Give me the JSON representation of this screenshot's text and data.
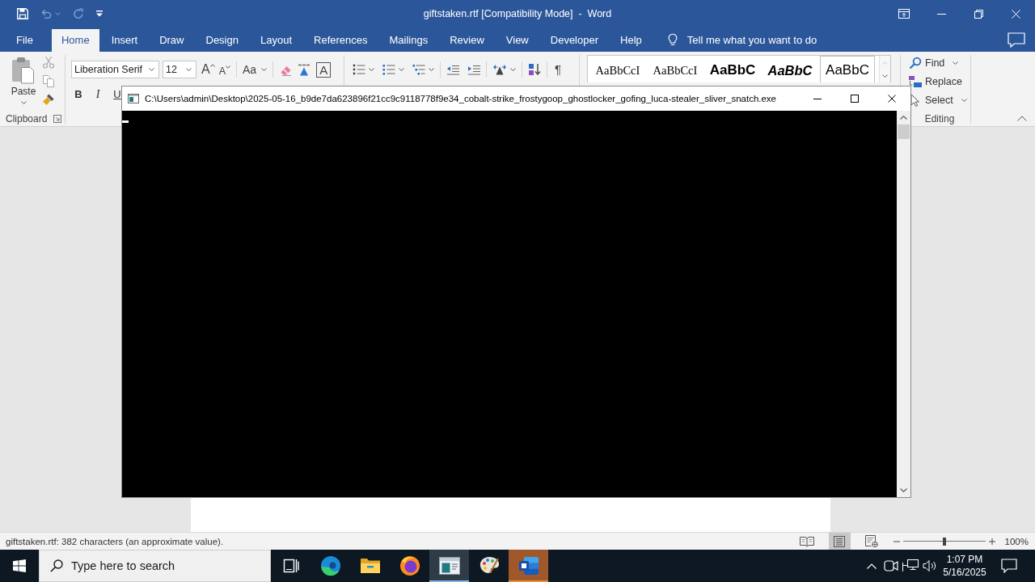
{
  "word_window": {
    "quick_access": [
      {
        "kind": "save",
        "disabled": false
      },
      {
        "kind": "undo",
        "disabled": true
      },
      {
        "kind": "repeat",
        "disabled": true
      },
      {
        "kind": "customize",
        "disabled": false
      }
    ],
    "title": "giftstaken.rtf [Compatibility Mode]  -  Word",
    "window_controls": [
      {
        "kind": "ribbon-options"
      },
      {
        "kind": "minimize"
      },
      {
        "kind": "restore"
      },
      {
        "kind": "close"
      }
    ],
    "tabs": [
      {
        "label": "File",
        "selected": false
      },
      {
        "label": "Home",
        "selected": true
      },
      {
        "label": "Insert",
        "selected": false
      },
      {
        "label": "Draw",
        "selected": false
      },
      {
        "label": "Design",
        "selected": false
      },
      {
        "label": "Layout",
        "selected": false
      },
      {
        "label": "References",
        "selected": false
      },
      {
        "label": "Mailings",
        "selected": false
      },
      {
        "label": "Review",
        "selected": false
      },
      {
        "label": "View",
        "selected": false
      },
      {
        "label": "Developer",
        "selected": false
      },
      {
        "label": "Help",
        "selected": false
      }
    ],
    "tell_me": {
      "placeholder": "Tell me what you want to do"
    },
    "ribbon": {
      "clipboard": {
        "paste": {
          "label": "Paste",
          "disabled": true
        },
        "tools": [
          {
            "kind": "cut",
            "disabled": true
          },
          {
            "kind": "copy",
            "disabled": true
          },
          {
            "kind": "format-painter",
            "disabled": false
          }
        ],
        "group_label": "Clipboard"
      },
      "font": {
        "font_name": "Liberation Serif",
        "font_size": "12",
        "tools": [
          [
            {
              "kind": "grow",
              "label": "A"
            },
            {
              "kind": "shrink",
              "label": "A"
            }
          ],
          [
            {
              "kind": "change-case",
              "label": "Aa"
            }
          ],
          [
            {
              "kind": "clear-formatting"
            },
            {
              "kind": "phonetic-guide"
            },
            {
              "kind": "character-border",
              "label": "A"
            }
          ]
        ],
        "format": [
          {
            "kind": "bold",
            "label": "B"
          },
          {
            "kind": "italic",
            "label": "I"
          },
          {
            "kind": "underline",
            "label": "U"
          }
        ]
      },
      "paragraph": {
        "tools": [
          [
            {
              "kind": "bullets"
            },
            {
              "kind": "numbering"
            },
            {
              "kind": "multilevel"
            }
          ],
          [
            {
              "kind": "decrease-indent"
            },
            {
              "kind": "increase-indent"
            }
          ],
          [
            {
              "kind": "character-scaling"
            }
          ],
          [
            {
              "kind": "sort"
            }
          ],
          [
            {
              "kind": "show-marks",
              "label": "¶"
            }
          ]
        ]
      },
      "styles": [
        {
          "kind": "serif",
          "sample": "AaBbCcI",
          "selected": false
        },
        {
          "kind": "serif",
          "sample": "AaBbCcI",
          "selected": false
        },
        {
          "kind": "sans-large",
          "sample": "AaBbC",
          "selected": false
        },
        {
          "kind": "sans-italic",
          "sample": "AaBbC",
          "selected": false
        },
        {
          "kind": "sans",
          "sample": "AaBbC",
          "selected": true
        }
      ],
      "gallery_scroll": [
        {
          "kind": "up",
          "disabled": true
        },
        {
          "kind": "down",
          "disabled": false
        }
      ],
      "editing": {
        "tools": [
          {
            "kind": "find",
            "label": "Find"
          },
          {
            "kind": "replace",
            "label": "Replace"
          },
          {
            "kind": "select",
            "label": "Select"
          }
        ],
        "group_label": "Editing"
      }
    },
    "status_bar": {
      "text": "giftstaken.rtf: 382 characters (an approximate value).",
      "views": [
        {
          "kind": "read",
          "selected": false
        },
        {
          "kind": "print",
          "selected": true
        },
        {
          "kind": "web",
          "selected": false
        }
      ],
      "zoom": {
        "level": 0.5,
        "reading": "100%"
      }
    }
  },
  "console_window": {
    "title": "C:\\Users\\admin\\Desktop\\2025-05-16_b9de7da623896f21cc9c9118778f9e34_cobalt-strike_frostygoop_ghostlocker_gofing_luca-stealer_sliver_snatch.exe"
  },
  "taskbar": {
    "search": {
      "placeholder": "Type here to search"
    },
    "apps": [
      {
        "kind": "task-view",
        "active": false,
        "attention": false
      },
      {
        "kind": "edge",
        "active": false,
        "attention": false
      },
      {
        "kind": "explorer",
        "active": false,
        "attention": false
      },
      {
        "kind": "firefox",
        "active": false,
        "attention": false
      },
      {
        "kind": "console",
        "active": true,
        "attention": false
      },
      {
        "kind": "paint",
        "active": false,
        "attention": false
      },
      {
        "kind": "word",
        "active": false,
        "attention": true
      }
    ],
    "tray": [
      {
        "kind": "chevron"
      },
      {
        "kind": "meeting"
      },
      {
        "kind": "network"
      },
      {
        "kind": "volume"
      }
    ],
    "clock": {
      "time": "1:07 PM",
      "date": "5/16/2025"
    }
  }
}
